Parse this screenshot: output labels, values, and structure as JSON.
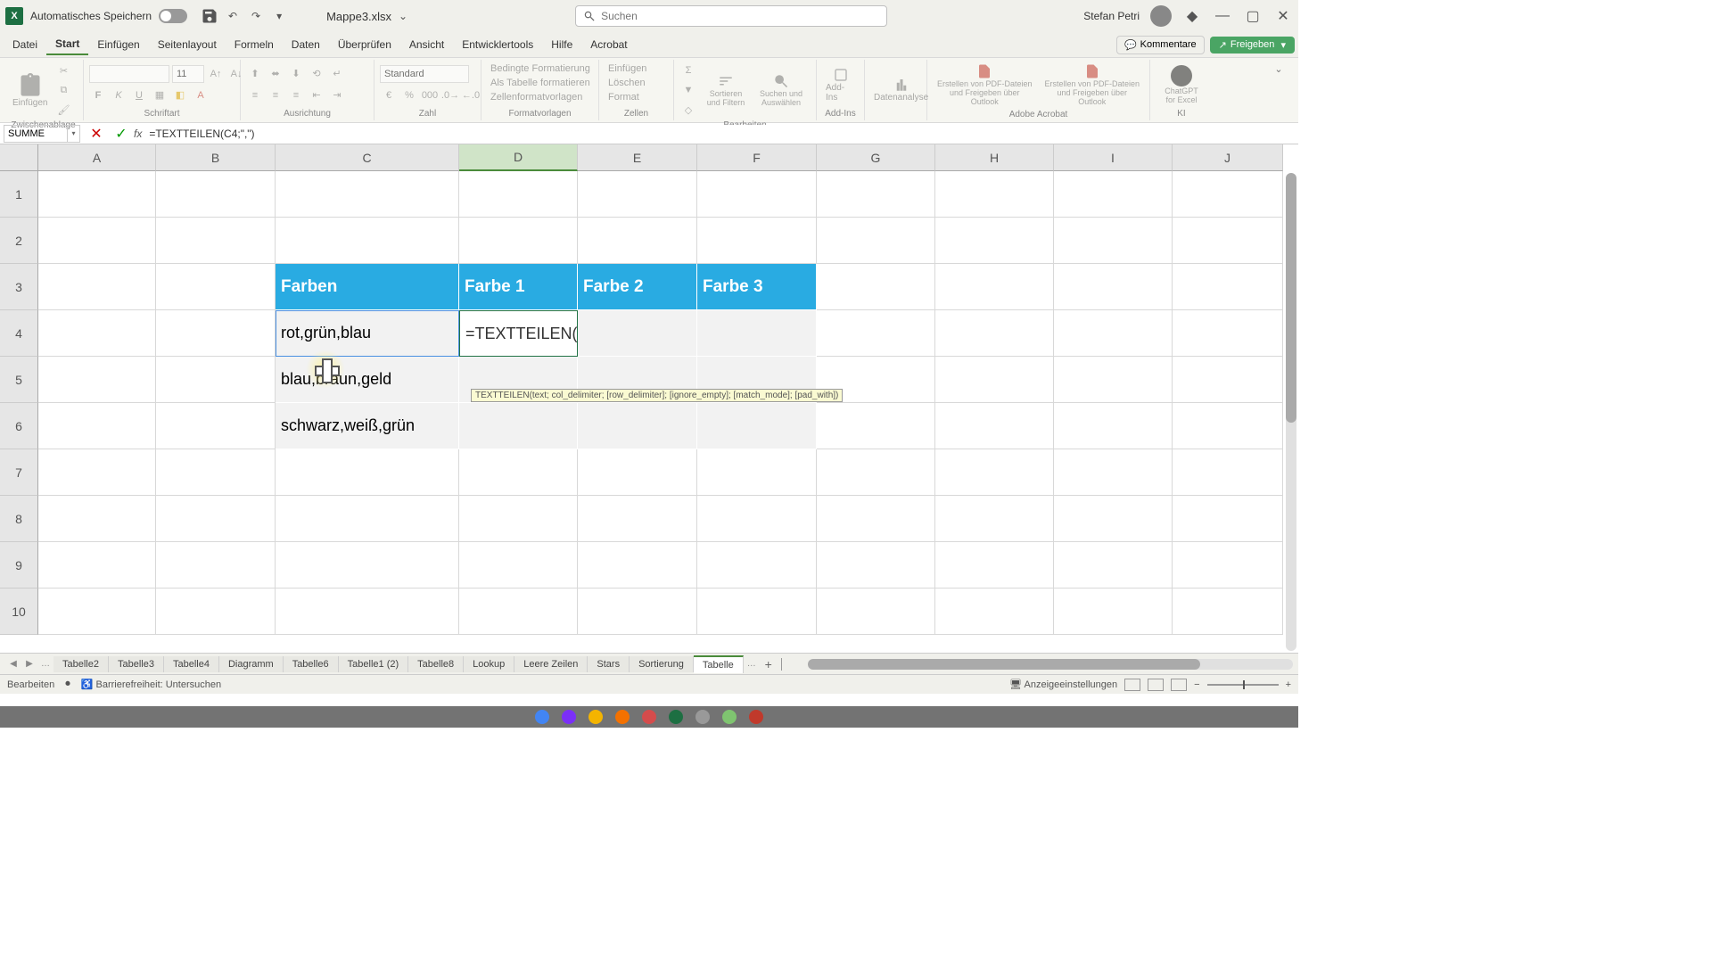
{
  "titlebar": {
    "autosave_label": "Automatisches Speichern",
    "filename": "Mappe3.xlsx",
    "search_placeholder": "Suchen",
    "user_name": "Stefan Petri"
  },
  "menu": {
    "tabs": [
      "Datei",
      "Start",
      "Einfügen",
      "Seitenlayout",
      "Formeln",
      "Daten",
      "Überprüfen",
      "Ansicht",
      "Entwicklertools",
      "Hilfe",
      "Acrobat"
    ],
    "active": 1,
    "kommentare": "Kommentare",
    "freigeben": "Freigeben"
  },
  "ribbon": {
    "groups": {
      "zwischenablage": "Zwischenablage",
      "schriftart": "Schriftart",
      "ausrichtung": "Ausrichtung",
      "zahl": "Zahl",
      "formatvorlagen": "Formatvorlagen",
      "zellen": "Zellen",
      "bearbeiten": "Bearbeiten",
      "addins": "Add-Ins",
      "datenanalyse_grp": "",
      "acrobat": "Adobe Acrobat",
      "ki": "KI"
    },
    "paste_label": "Einfügen",
    "number_format": "Standard",
    "fmt_bedingt": "Bedingte Formatierung",
    "fmt_tabelle": "Als Tabelle formatieren",
    "fmt_vorlagen": "Zellenformatvorlagen",
    "cells_einfuegen": "Einfügen",
    "cells_loeschen": "Löschen",
    "cells_format": "Format",
    "sort_filter": "Sortieren und Filtern",
    "suchen_auswaehlen": "Suchen und Auswählen",
    "addins_label": "Add-Ins",
    "datenanalyse": "Datenanalyse",
    "pdf1": "Erstellen von PDF-Dateien und Freigeben über Outlook",
    "pdf2": "Erstellen von PDF-Dateien und Freigeben über Outlook",
    "chatgpt": "ChatGPT for Excel"
  },
  "formula_bar": {
    "name_box": "SUMME",
    "formula": "=TEXTTEILEN(C4;\",\")"
  },
  "sheet": {
    "cols": [
      "A",
      "B",
      "C",
      "D",
      "E",
      "F",
      "G",
      "H",
      "I",
      "J"
    ],
    "rows": [
      "1",
      "2",
      "3",
      "4",
      "5",
      "6",
      "7",
      "8",
      "9",
      "10"
    ],
    "headers": {
      "c3": "Farben",
      "d3": "Farbe 1",
      "e3": "Farbe 2",
      "f3": "Farbe 3"
    },
    "data": {
      "c4": "rot,grün,blau",
      "c5": "blau,braun,geld",
      "c6": "schwarz,weiß,grün"
    },
    "edit_cell": {
      "prefix": "=TEXTTEILEN(",
      "ref": "C4",
      "suffix": ";\",\")"
    },
    "tooltip": "TEXTTEILEN(text; col_delimiter; [row_delimiter]; [ignore_empty]; [match_mode]; [pad_with])"
  },
  "sheet_tabs": {
    "tabs": [
      "Tabelle2",
      "Tabelle3",
      "Tabelle4",
      "Diagramm",
      "Tabelle6",
      "Tabelle1 (2)",
      "Tabelle8",
      "Lookup",
      "Leere Zeilen",
      "Stars",
      "Sortierung",
      "Tabelle"
    ],
    "active": 11
  },
  "statusbar": {
    "mode": "Bearbeiten",
    "accessibility": "Barrierefreiheit: Untersuchen",
    "display_settings": "Anzeigeeinstellungen"
  }
}
